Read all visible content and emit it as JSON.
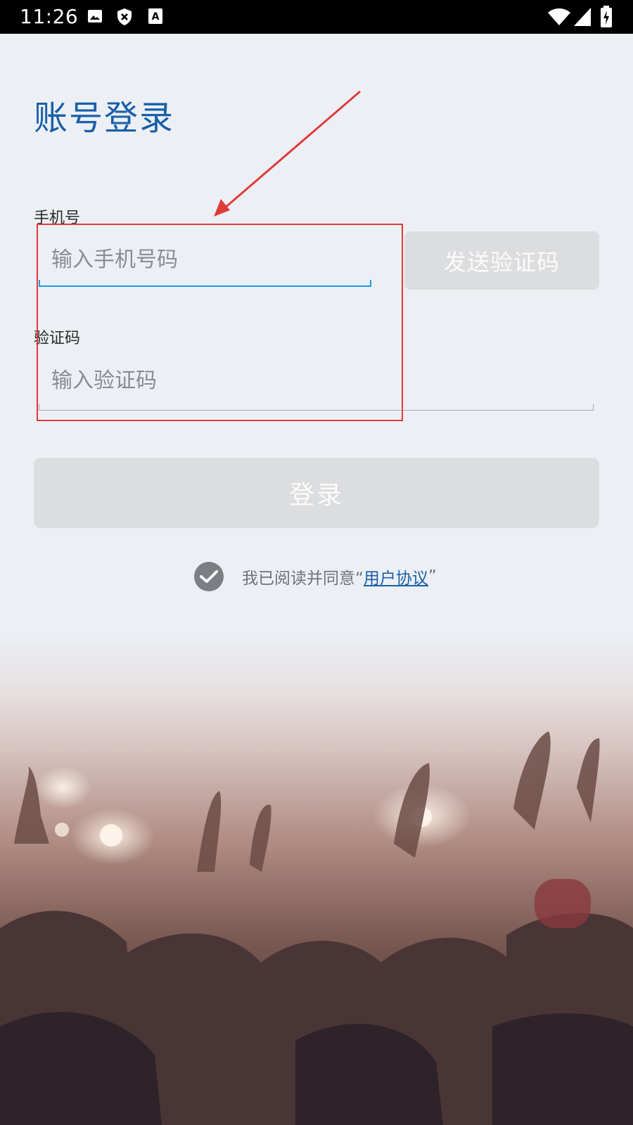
{
  "status_bar": {
    "time": "11:26",
    "left_icons": [
      "image-icon",
      "shield-x-icon",
      "text-a-icon"
    ],
    "right_icons": [
      "wifi-icon",
      "cell-signal-icon",
      "battery-charging-icon"
    ]
  },
  "page": {
    "title": "账号登录"
  },
  "phone_field": {
    "label": "手机号",
    "placeholder": "输入手机号码",
    "value": ""
  },
  "send_code_button": {
    "label": "发送验证码"
  },
  "code_field": {
    "label": "验证码",
    "placeholder": "输入验证码",
    "value": ""
  },
  "login_button": {
    "label": "登录"
  },
  "agreement": {
    "checked": true,
    "text_prefix": "我已阅读并同意“",
    "link_text": "用户协议",
    "text_suffix": "”"
  },
  "colors": {
    "accent": "#1a5fa8",
    "input_focus": "#1a9be0",
    "disabled_button": "#dcdddf",
    "annotation": "#e03b3b"
  }
}
